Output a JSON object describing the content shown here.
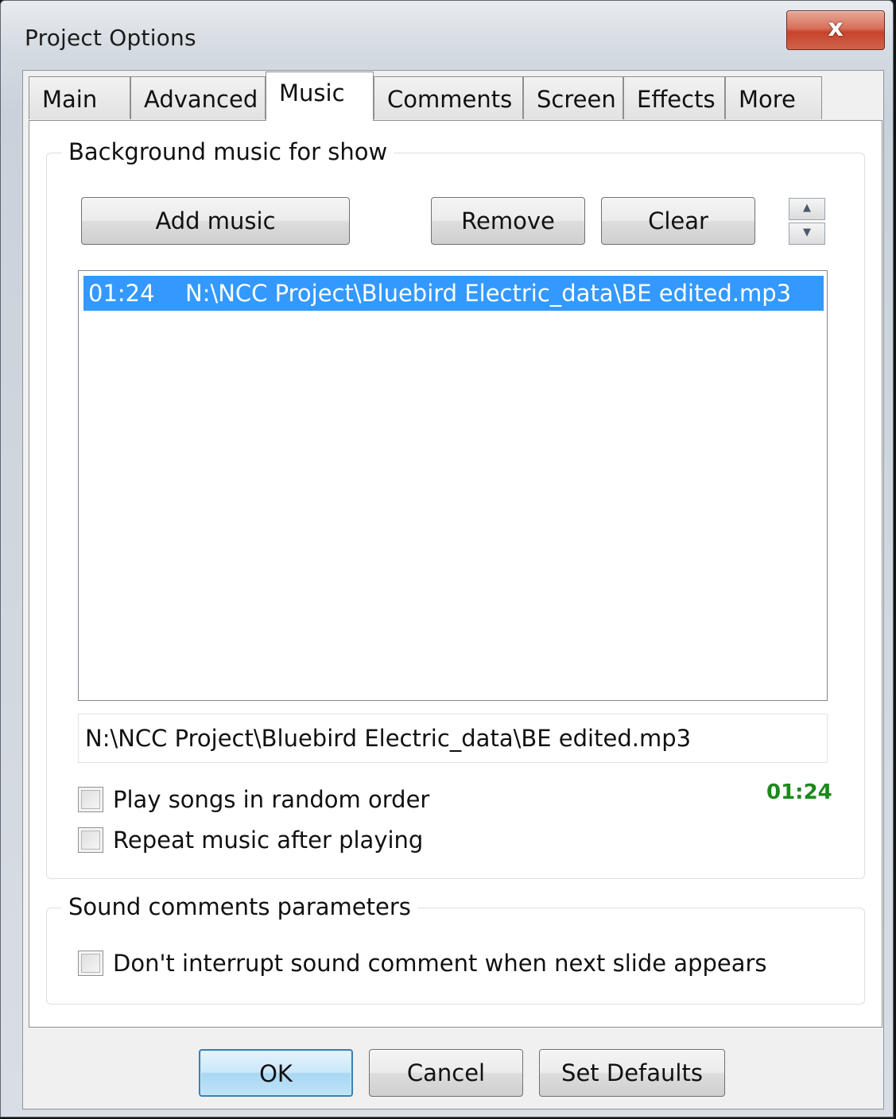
{
  "window": {
    "title": "Project Options",
    "close_label": "x"
  },
  "tabs": [
    {
      "label": "Main"
    },
    {
      "label": "Advanced"
    },
    {
      "label": "Music"
    },
    {
      "label": "Comments"
    },
    {
      "label": "Screen"
    },
    {
      "label": "Effects"
    },
    {
      "label": "More"
    }
  ],
  "background_music": {
    "group_label": "Background music for show",
    "add_music_label": "Add music",
    "remove_label": "Remove",
    "clear_label": "Clear",
    "list": [
      {
        "duration": "01:24",
        "path": "N:\\NCC Project\\Bluebird Electric_data\\BE edited.mp3",
        "selected": true
      }
    ],
    "selected_path": "N:\\NCC Project\\Bluebird Electric_data\\BE edited.mp3",
    "total_time": "01:24",
    "random_order": {
      "label": "Play songs in random order",
      "checked": false
    },
    "repeat_music": {
      "label": "Repeat music after playing",
      "checked": false
    }
  },
  "sound_comments": {
    "group_label": "Sound comments parameters",
    "dont_interrupt": {
      "label": "Don't interrupt sound comment when next slide appears",
      "checked": false
    }
  },
  "footer": {
    "ok_label": "OK",
    "cancel_label": "Cancel",
    "defaults_label": "Set Defaults"
  },
  "colors": {
    "selection": "#3399ff",
    "time_green": "#1b8a1b",
    "close_red": "#c7432b"
  }
}
